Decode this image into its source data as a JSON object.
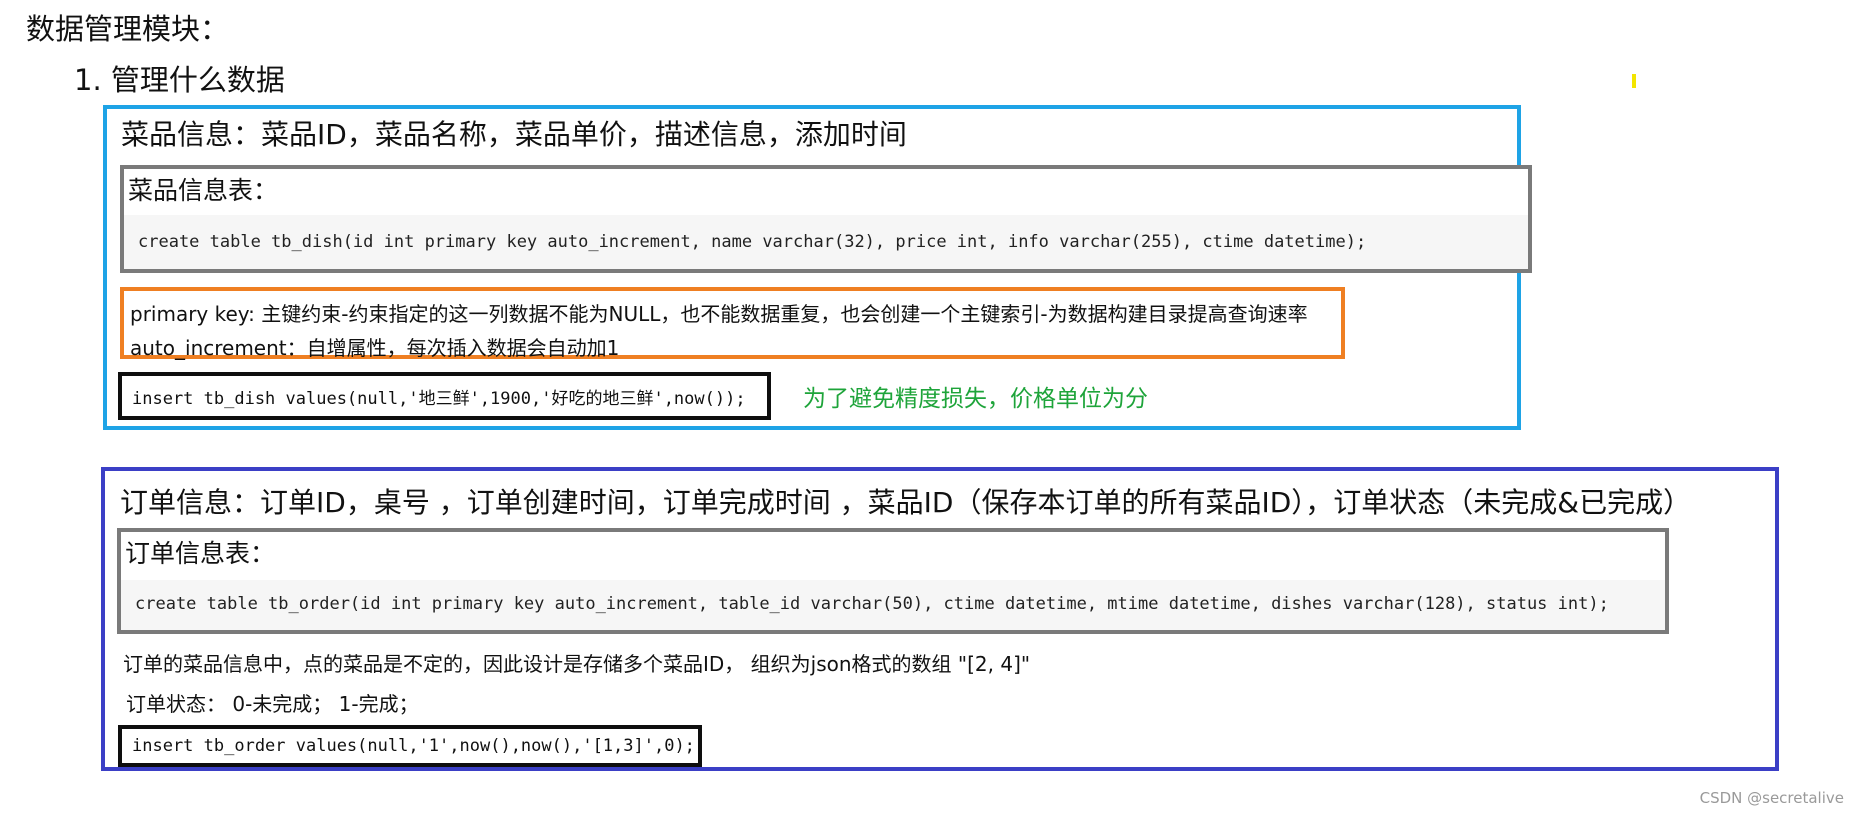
{
  "heading": "数据管理模块：",
  "subheading": "1. 管理什么数据",
  "dish": {
    "title": "菜品信息：菜品ID，菜品名称，菜品单价，描述信息，添加时间",
    "table_label": "菜品信息表：",
    "create_sql": "create table tb_dish(id int primary key auto_increment, name varchar(32), price int, info varchar(255), ctime datetime);",
    "notes": [
      "primary key: 主键约束-约束指定的这一列数据不能为NULL，也不能数据重复，也会创建一个主键索引-为数据构建目录提高查询速率",
      "auto_increment：自增属性，每次插入数据会自动加1"
    ],
    "insert_sql": "insert tb_dish values(null,'地三鲜',1900,'好吃的地三鲜',now());",
    "price_note": "为了避免精度损失，价格单位为分"
  },
  "order": {
    "title": "订单信息：订单ID，桌号 ，订单创建时间，订单完成时间 ，菜品ID（保存本订单的所有菜品ID），订单状态（未完成&已完成）",
    "table_label": "订单信息表：",
    "create_sql": "create table tb_order(id int primary key auto_increment, table_id varchar(50), ctime datetime, mtime datetime, dishes varchar(128), status int);",
    "desc": "订单的菜品信息中，点的菜品是不定的，因此设计是存储多个菜品ID， 组织为json格式的数组    \"[2, 4]\"",
    "status": "订单状态： 0-未完成； 1-完成；",
    "insert_sql": "insert tb_order values(null,'1',now(),now(),'[1,3]',0);"
  },
  "footer": "CSDN @secretalive",
  "colors": {
    "dish_border": "#1ea3e6",
    "order_border": "#3b3fc6",
    "table_border": "#7a7a7a",
    "note_border": "#ef7f22",
    "insert_border": "#0e0e0e",
    "green_text": "#1ea43a"
  }
}
